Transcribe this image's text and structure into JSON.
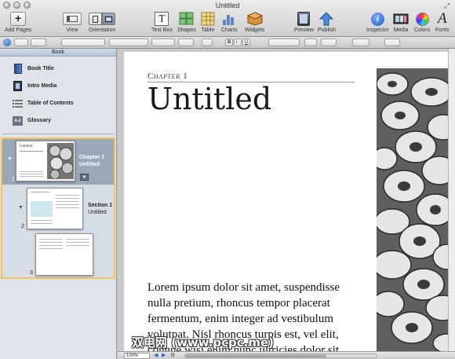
{
  "window": {
    "title": "Untitled"
  },
  "toolbar": {
    "add_pages": "Add Pages",
    "view": "View",
    "orientation": "Orientation",
    "text_box": "Text Box",
    "shapes": "Shapes",
    "table": "Table",
    "charts": "Charts",
    "widgets": "Widgets",
    "preview": "Preview",
    "publish": "Publish",
    "inspector": "Inspector",
    "media": "Media",
    "colors": "Colors",
    "fonts": "Fonts"
  },
  "formatbar": {
    "bold": "B",
    "italic": "I",
    "underline": "U"
  },
  "sidebar": {
    "header": "Book",
    "items": [
      {
        "label": "Book Title",
        "icon": "book-icon"
      },
      {
        "label": "Intro Media",
        "icon": "media-icon"
      },
      {
        "label": "Table of Contents",
        "icon": "list-icon"
      },
      {
        "label": "Glossary",
        "icon": "glossary-icon"
      }
    ],
    "pages": [
      {
        "number": "1",
        "caption_line1": "Chapter 1",
        "caption_line2": "Untitled",
        "thumb_title": "Untitled"
      },
      {
        "number": "2",
        "caption_line1": "Section 1",
        "caption_line2": "Untitled"
      },
      {
        "number": "3"
      }
    ]
  },
  "document": {
    "chapter_label": "Chapter 1",
    "title": "Untitled",
    "body": "Lorem ipsum dolor sit amet, suspendisse nulla pretium, rhoncus tempor placerat fermentum, enim integer ad vestibulum volutpat. Nisl rhoncus turpis est, vel elit, congue wisi enim nunc ultricies dolor sit."
  },
  "watermark": "双电网 (www.pcpc.me)",
  "statusbar": {
    "zoom": "100%"
  }
}
